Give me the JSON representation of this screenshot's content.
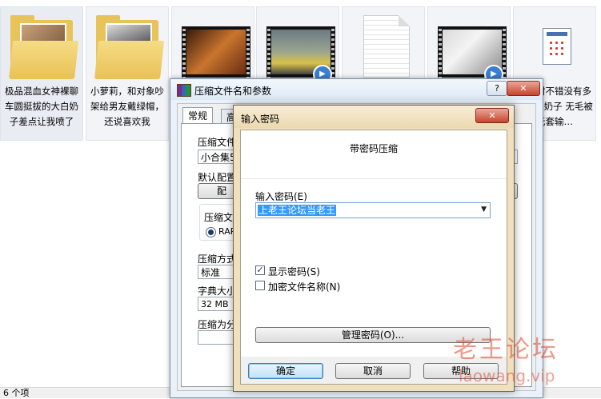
{
  "explorer": {
    "files": [
      {
        "caption": "极品混血女神裸聊车圆挺拔的大白奶子差点让我喷了",
        "kind": "folder"
      },
      {
        "caption": "小萝莉，和对象吵架给男友戴绿帽，还说喜欢我",
        "kind": "folder"
      },
      {
        "caption": "",
        "kind": "video"
      },
      {
        "caption": "",
        "kind": "video"
      },
      {
        "caption": "",
        "kind": "document"
      },
      {
        "caption": "",
        "kind": "video"
      },
      {
        "caption": "童身材不错没有多余的大奶子 无毛被无套输…",
        "kind": "application"
      }
    ],
    "status_text": "6 个项"
  },
  "archive_dialog": {
    "title": "压缩文件名和参数",
    "help_btn": "?",
    "close_btn": "✕",
    "tabs": [
      "常规",
      "高"
    ],
    "archive_name_label": "压缩文件",
    "archive_name_value": "小合集5",
    "default_profile_label": "默认配置",
    "profile_button": "配",
    "format_group_label": "压缩文件",
    "format_rar": "RAR",
    "method_label": "压缩方式",
    "method_value": "标准",
    "dict_label": "字典大小",
    "dict_value": "32 MB",
    "split_label": "压缩为分"
  },
  "password_dialog": {
    "title": "输入密码",
    "heading": "带密码压缩",
    "password_label": "输入密码(E)",
    "password_value": "上老王论坛当老王",
    "show_password": "显示密码(S)",
    "show_password_checked": true,
    "encrypt_names": "加密文件名称(N)",
    "encrypt_names_checked": false,
    "manage_button": "管理密码(O)...",
    "ok_button": "确定",
    "cancel_button": "取消",
    "help_button": "帮助",
    "close_btn": "✕"
  },
  "watermark": {
    "line1": "老王论坛",
    "line2": "laowang.vip"
  }
}
